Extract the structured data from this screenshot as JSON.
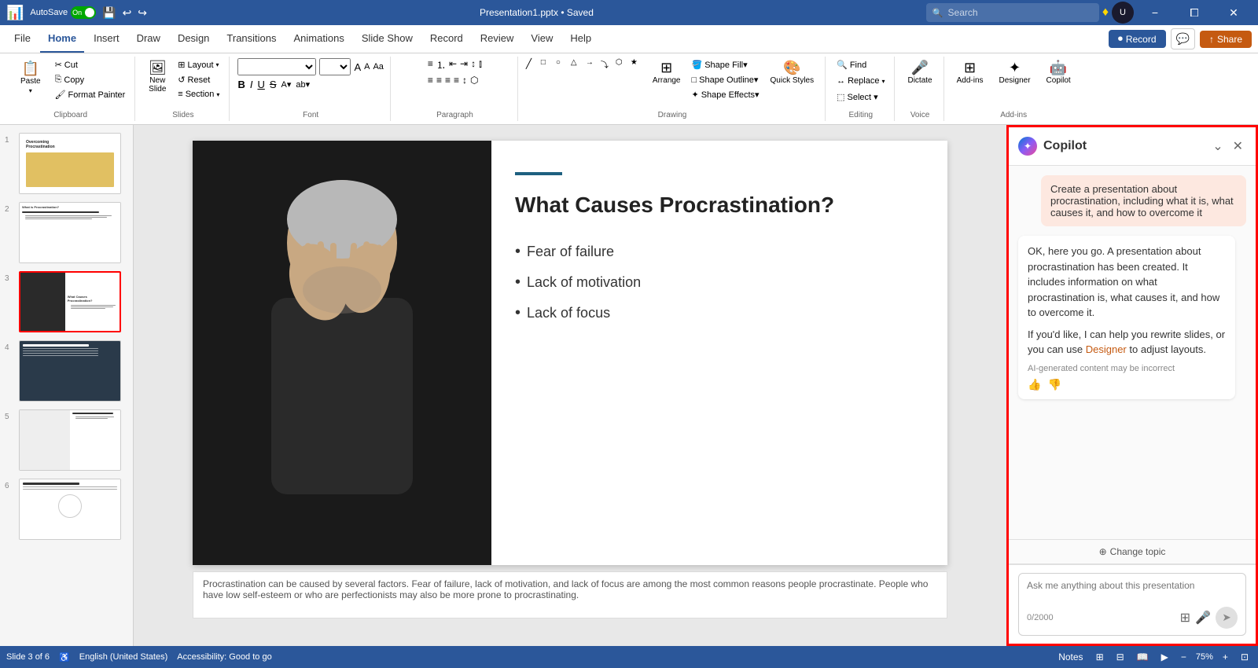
{
  "app": {
    "name": "PowerPoint",
    "icon": "📊",
    "autosave_label": "AutoSave",
    "autosave_on": "On",
    "file_name": "Presentation1.pptx • Saved",
    "minimize": "−",
    "restore": "⧠",
    "close": "✕"
  },
  "search": {
    "placeholder": "Search"
  },
  "tabs": {
    "items": [
      {
        "id": "file",
        "label": "File"
      },
      {
        "id": "home",
        "label": "Home",
        "active": true
      },
      {
        "id": "insert",
        "label": "Insert"
      },
      {
        "id": "draw",
        "label": "Draw"
      },
      {
        "id": "design",
        "label": "Design"
      },
      {
        "id": "transitions",
        "label": "Transitions"
      },
      {
        "id": "animations",
        "label": "Animations"
      },
      {
        "id": "slideshow",
        "label": "Slide Show"
      },
      {
        "id": "record",
        "label": "Record"
      },
      {
        "id": "review",
        "label": "Review"
      },
      {
        "id": "view",
        "label": "View"
      },
      {
        "id": "help",
        "label": "Help"
      }
    ]
  },
  "ribbon": {
    "clipboard": {
      "label": "Clipboard",
      "paste": "Paste",
      "cut": "✂",
      "copy": "⎘",
      "format_painter": "🖌"
    },
    "slides": {
      "label": "Slides",
      "new_slide": "New Slide",
      "layout": "Layout",
      "reset": "Reset",
      "section": "Section"
    },
    "font": {
      "label": "Font",
      "bold": "B",
      "italic": "I",
      "underline": "U",
      "strikethrough": "S"
    },
    "paragraph": {
      "label": "Paragraph"
    },
    "drawing": {
      "label": "Drawing",
      "arrange": "Arrange",
      "quick_styles": "Quick Styles"
    },
    "editing": {
      "label": "Editing",
      "find": "Find",
      "replace": "Replace",
      "select": "Select ▾"
    },
    "voice": {
      "label": "Voice",
      "dictate": "Dictate"
    },
    "add_ins": {
      "label": "Add-ins",
      "add_ins_btn": "Add-ins",
      "designer": "Designer",
      "copilot": "Copilot"
    }
  },
  "header_actions": {
    "record_label": "Record",
    "comments_icon": "💬",
    "share_label": "Share"
  },
  "slides": [
    {
      "num": 1,
      "title": "Overcoming Procrastination",
      "active": false
    },
    {
      "num": 2,
      "title": "What is Procrastination?",
      "active": false
    },
    {
      "num": 3,
      "title": "What Causes Procrastination?",
      "active": true
    },
    {
      "num": 4,
      "title": "Tips to Overcome Procrastination",
      "active": false
    },
    {
      "num": 5,
      "title": "Conclusion alt",
      "active": false
    },
    {
      "num": 6,
      "title": "Conclusion",
      "active": false
    }
  ],
  "current_slide": {
    "title": "What Causes Procrastination?",
    "bullets": [
      "Fear of failure",
      "Lack of motivation",
      "Lack of focus"
    ]
  },
  "notes_text": "Procrastination can be caused by several factors. Fear of failure, lack of motivation, and lack of focus are among the most common reasons people procrastinate. People who have low self-esteem or who are perfectionists may also be more prone to procrastinating.",
  "status_bar": {
    "slide_info": "Slide 3 of 6",
    "language": "English (United States)",
    "accessibility": "Accessibility: Good to go",
    "notes": "Notes",
    "zoom": "75%"
  },
  "copilot": {
    "title": "Copilot",
    "user_message": "Create a presentation about procrastination, including what it is, what causes it, and how to overcome it",
    "ai_response_1": "OK, here you go. A presentation about procrastination has been created. It includes information on what procrastination is, what causes it, and how to overcome it.",
    "ai_response_2": "If you'd like, I can help you rewrite slides, or you can use",
    "ai_link": "Designer",
    "ai_response_3": "to adjust layouts.",
    "ai_disclaimer": "AI-generated content may be incorrect",
    "change_topic": "Change topic",
    "input_placeholder": "Ask me anything about this presentation",
    "char_count": "0/2000"
  }
}
